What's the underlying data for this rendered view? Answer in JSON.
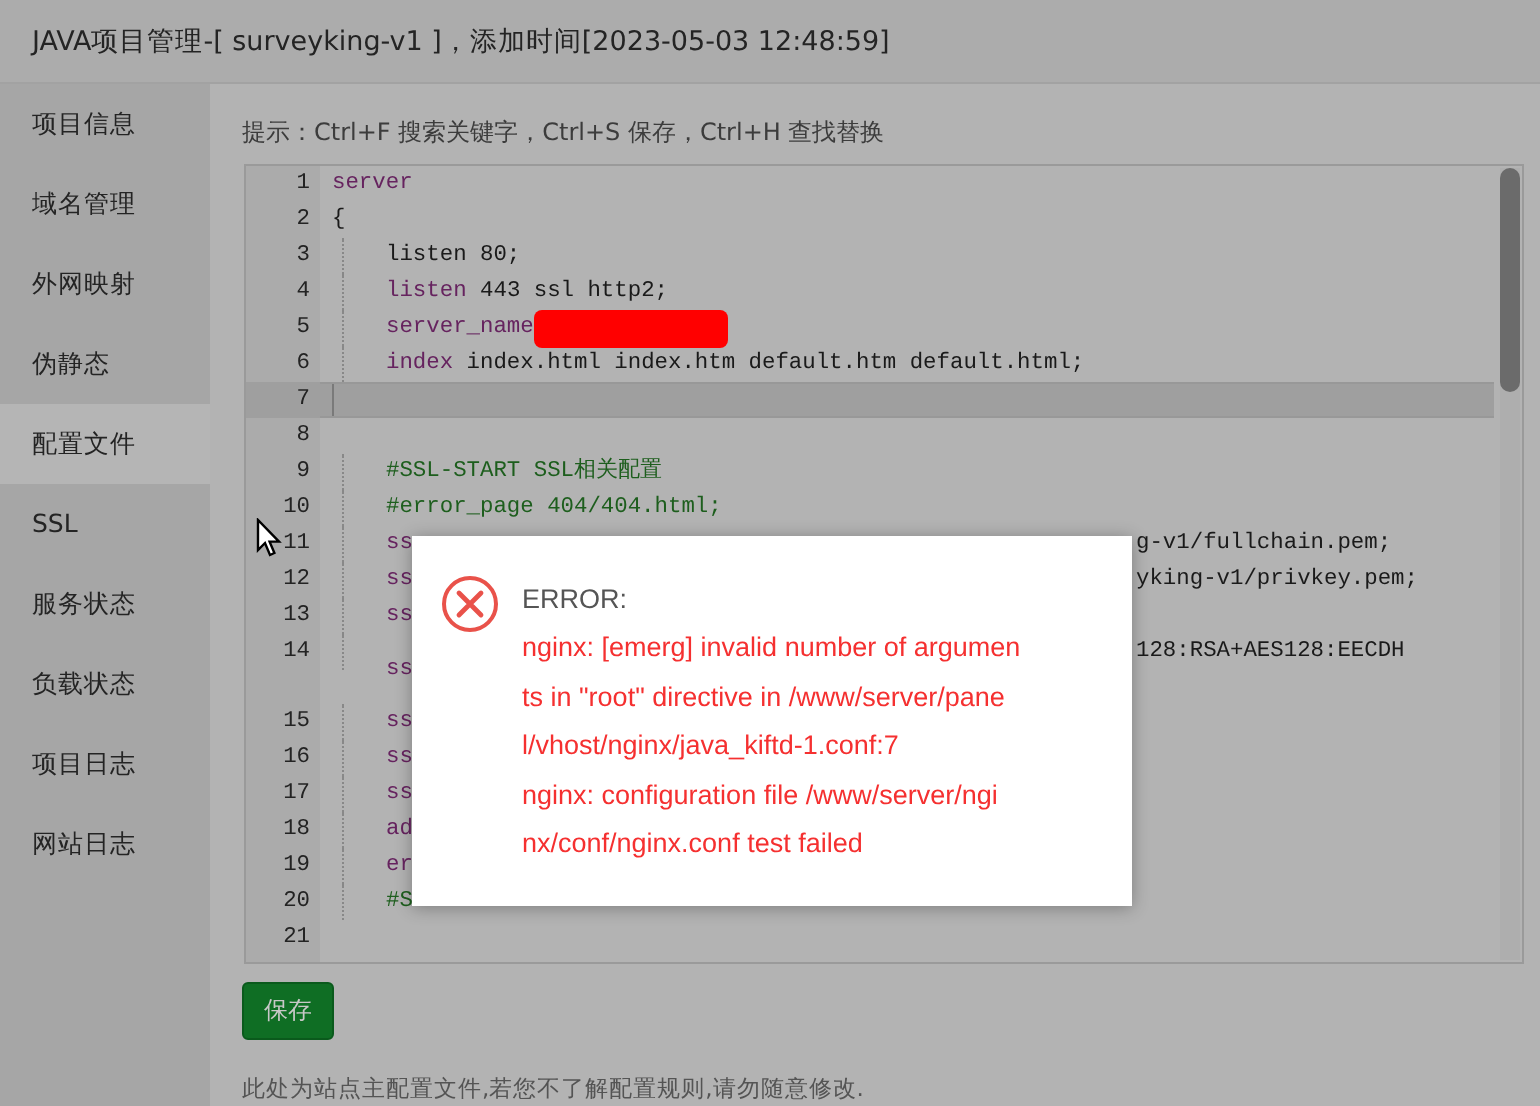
{
  "window": {
    "title": "JAVA项目管理-[ surveyking-v1 ]，添加时间[2023-05-03 12:48:59]"
  },
  "sidebar": {
    "items": [
      {
        "label": "项目信息",
        "selected": false
      },
      {
        "label": "域名管理",
        "selected": false
      },
      {
        "label": "外网映射",
        "selected": false
      },
      {
        "label": "伪静态",
        "selected": false
      },
      {
        "label": "配置文件",
        "selected": true
      },
      {
        "label": "SSL",
        "selected": false
      },
      {
        "label": "服务状态",
        "selected": false
      },
      {
        "label": "负载状态",
        "selected": false
      },
      {
        "label": "项目日志",
        "selected": false
      },
      {
        "label": "网站日志",
        "selected": false
      }
    ]
  },
  "editor": {
    "hint": "提示：Ctrl+F 搜索关键字，Ctrl+S 保存，Ctrl+H 查找替换",
    "lines": [
      {
        "number": "1",
        "indented": false,
        "active": false,
        "tokens": [
          {
            "kind": "keyword",
            "text": "server"
          }
        ]
      },
      {
        "number": "2",
        "indented": false,
        "active": false,
        "tokens": [
          {
            "kind": "plain",
            "text": "{"
          }
        ]
      },
      {
        "number": "3",
        "indented": true,
        "active": false,
        "tokens": [
          {
            "kind": "plain",
            "text": "listen 80;"
          }
        ]
      },
      {
        "number": "4",
        "indented": true,
        "active": false,
        "tokens": [
          {
            "kind": "keyword",
            "text": "listen"
          },
          {
            "kind": "plain",
            "text": " 443 ssl http2;"
          }
        ]
      },
      {
        "number": "5",
        "indented": true,
        "active": false,
        "tokens": [
          {
            "kind": "keyword",
            "text": "server_name"
          },
          {
            "kind": "redaction"
          }
        ]
      },
      {
        "number": "6",
        "indented": true,
        "active": false,
        "tokens": [
          {
            "kind": "keyword",
            "text": "index"
          },
          {
            "kind": "plain",
            "text": " index.html index.htm default.htm default.html;"
          }
        ]
      },
      {
        "number": "7",
        "indented": false,
        "active": true
      },
      {
        "number": "8",
        "indented": false,
        "active": false
      },
      {
        "number": "9",
        "indented": true,
        "active": false,
        "tokens": [
          {
            "kind": "comment",
            "text": "#SSL-START SSL相关配置"
          }
        ]
      },
      {
        "number": "10",
        "indented": true,
        "active": false,
        "tokens": [
          {
            "kind": "comment",
            "text": "#error_page 404/404.html;"
          }
        ]
      },
      {
        "number": "11",
        "indented": true,
        "active": false,
        "tokens": [
          {
            "kind": "keyword",
            "text": "ss"
          }
        ],
        "after_dialog": [
          {
            "kind": "plain",
            "text": "g-v1/fullchain.pem;"
          }
        ]
      },
      {
        "number": "12",
        "indented": true,
        "active": false,
        "tokens": [
          {
            "kind": "keyword",
            "text": "ss"
          }
        ],
        "after_dialog": [
          {
            "kind": "plain",
            "text": "yking-v1/privkey.pem;"
          }
        ]
      },
      {
        "number": "13",
        "indented": true,
        "active": false,
        "tokens": [
          {
            "kind": "keyword",
            "text": "ss"
          }
        ]
      },
      {
        "number": "14",
        "indented": true,
        "active": false,
        "wrapped": true,
        "tokens": [
          {
            "kind": "keyword",
            "text": "ss"
          }
        ],
        "after_dialog": [
          {
            "kind": "plain",
            "text": "128:RSA+AES128:EECDH"
          }
        ]
      },
      {
        "number": "15",
        "indented": true,
        "active": false,
        "tokens": [
          {
            "kind": "keyword",
            "text": "ss"
          }
        ]
      },
      {
        "number": "16",
        "indented": true,
        "active": false,
        "tokens": [
          {
            "kind": "keyword",
            "text": "ss"
          }
        ]
      },
      {
        "number": "17",
        "indented": true,
        "active": false,
        "tokens": [
          {
            "kind": "keyword",
            "text": "ss"
          }
        ]
      },
      {
        "number": "18",
        "indented": true,
        "active": false,
        "tokens": [
          {
            "kind": "keyword",
            "text": "ad"
          }
        ]
      },
      {
        "number": "19",
        "indented": true,
        "active": false,
        "tokens": [
          {
            "kind": "keyword",
            "text": "er"
          }
        ]
      },
      {
        "number": "20",
        "indented": true,
        "active": false,
        "tokens": [
          {
            "kind": "comment",
            "text": "#S"
          }
        ]
      },
      {
        "number": "21",
        "indented": false,
        "active": false
      }
    ]
  },
  "save_button": "保存",
  "footnote": "此处为站点主配置文件,若您不了解配置规则,请勿随意修改.",
  "dialog": {
    "heading": "ERROR:",
    "message_lines": [
      "nginx: [emerg] invalid number of argumen",
      "ts in \"root\" directive in /www/server/pane",
      "l/vhost/nginx/java_kiftd-1.conf:7",
      "nginx: configuration file /www/server/ngi",
      "nx/conf/nginx.conf test failed"
    ]
  }
}
